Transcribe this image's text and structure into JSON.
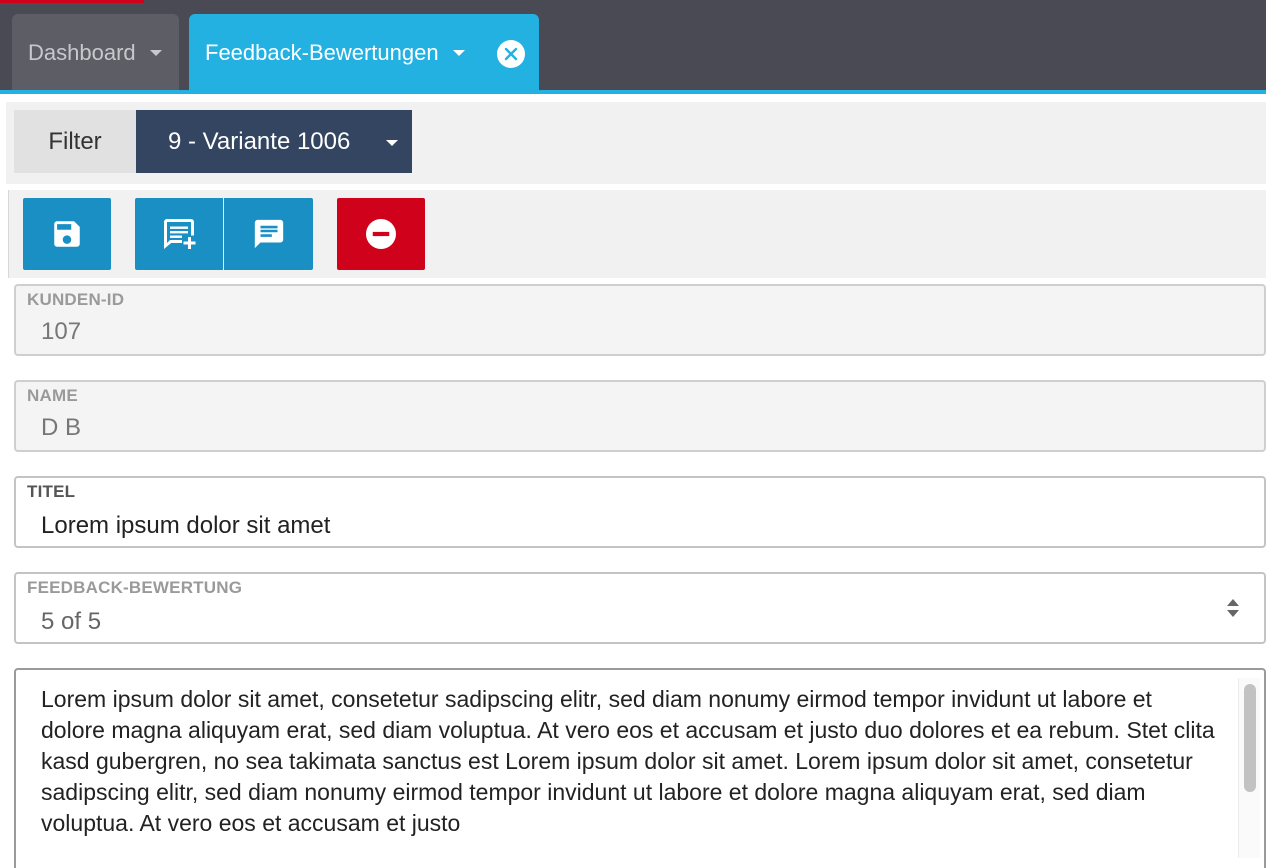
{
  "tabs": {
    "dashboard": {
      "label": "Dashboard"
    },
    "feedback": {
      "label": "Feedback-Bewertungen"
    }
  },
  "filter": {
    "label": "Filter",
    "selected": "9 - Variante 1006"
  },
  "toolbar": {
    "buttons": [
      {
        "icon": "save-icon"
      },
      {
        "icon": "add-comment-icon"
      },
      {
        "icon": "comment-icon"
      },
      {
        "icon": "delete-icon"
      }
    ]
  },
  "form": {
    "kunde_id": {
      "label": "KUNDEN-ID",
      "value": "107"
    },
    "name": {
      "label": "NAME",
      "value": "D B"
    },
    "titel": {
      "label": "TITEL",
      "value": "Lorem ipsum dolor sit amet"
    },
    "bewertung": {
      "label": "FEEDBACK-BEWERTUNG",
      "value": "5 of 5"
    },
    "text": "Lorem ipsum dolor sit amet, consetetur sadipscing elitr, sed diam nonumy eirmod tempor invidunt ut labore et dolore magna aliquyam erat, sed diam voluptua. At vero eos et accusam et justo duo dolores et ea rebum. Stet clita kasd gubergren, no sea takimata sanctus est Lorem ipsum dolor sit amet. Lorem ipsum dolor sit amet, consetetur sadipscing elitr, sed diam nonumy eirmod tempor invidunt ut labore et dolore magna aliquyam erat, sed diam voluptua. At vero eos et accusam et justo"
  },
  "colors": {
    "accent": "#23b1e2",
    "primary_button": "#1a8fc4",
    "danger": "#d0021b",
    "filter_select": "#334560"
  }
}
